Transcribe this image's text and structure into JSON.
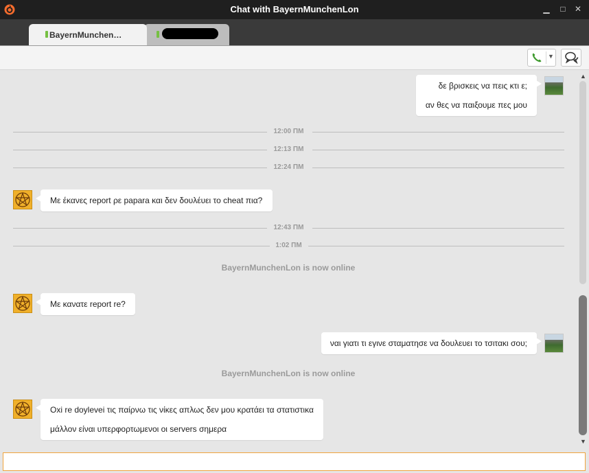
{
  "window": {
    "title": "Chat with BayernMunchenLon",
    "minimize": "▁",
    "maximize": "□",
    "close": "✕"
  },
  "tabs": [
    {
      "label": "BayernMunchen…",
      "active": true,
      "online": true
    },
    {
      "label": "",
      "active": false,
      "online": true,
      "redacted": true
    }
  ],
  "toolbar": {
    "call_icon": "phone-icon",
    "call_menu_icon": "chevron-down-icon",
    "chat_icon": "chat-bubbles-icon"
  },
  "messages": {
    "m1": {
      "from": "self",
      "lines": [
        "δε βρισκεις να πεις κτι ε;",
        "αν θες να παιξουμε πες μου"
      ]
    },
    "t1": "12:00 ΠΜ",
    "t2": "12:13 ΠΜ",
    "t3": "12:24 ΠΜ",
    "m2": {
      "from": "friend",
      "lines": [
        "Με έκανες report ρε papara και δεν δουλέυει το cheat πια?"
      ]
    },
    "t4": "12:43 ΠΜ",
    "t5": "1:02 ΠΜ",
    "s1": "BayernMunchenLon is now online",
    "m3": {
      "from": "friend",
      "lines": [
        "Με κανατε report re?"
      ]
    },
    "m4": {
      "from": "self",
      "lines": [
        "ναι γιατι τι εγινε σταματησε να δουλευει το τσιτακι σου;"
      ]
    },
    "s2": "BayernMunchenLon is now online",
    "m5": {
      "from": "friend",
      "lines": [
        "Oxi re doylevei τις παίρνω τις νίκες απλως δεν μου κρατάει τα στατιστικα",
        "μάλλον είναι υπερφορτωμενοι οι servers σημερα"
      ]
    }
  },
  "input": {
    "value": "",
    "placeholder": ""
  },
  "colors": {
    "titlebar": "#1f1f1f",
    "tabbar": "#3a3a3a",
    "chat_bg": "#e6e6e6",
    "online_green": "#76c043",
    "input_border": "#f0a43c",
    "origin_orange": "#f56c2d"
  }
}
